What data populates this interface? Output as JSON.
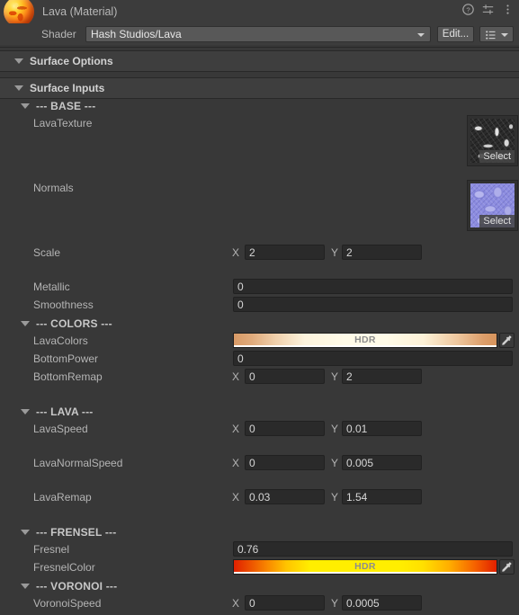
{
  "window": {
    "title": "Lava (Material)",
    "icons": [
      {
        "name": "help-icon",
        "glyph": "?"
      },
      {
        "name": "preset-icon",
        "glyph": "preset"
      },
      {
        "name": "more-menu-icon",
        "glyph": "⋮"
      }
    ]
  },
  "shader": {
    "label": "Shader",
    "value": "Hash Studios/Lava",
    "edit_label": "Edit...",
    "preset_tooltip": "Shader presets"
  },
  "sections": [
    {
      "name": "surface-options",
      "label": "Surface Options"
    },
    {
      "name": "surface-inputs",
      "label": "Surface Inputs"
    }
  ],
  "groups": {
    "base": "--- BASE ---",
    "colors": "--- COLORS ---",
    "lava": "--- LAVA ---",
    "frensel": "--- FRENSEL ---",
    "voronoi": "--- VORONOI ---"
  },
  "properties": {
    "lava_texture": {
      "label": "LavaTexture",
      "select_label": "Select"
    },
    "normals": {
      "label": "Normals",
      "select_label": "Select"
    },
    "scale": {
      "label": "Scale",
      "x_label": "X",
      "x": "2",
      "y_label": "Y",
      "y": "2"
    },
    "metallic": {
      "label": "Metallic",
      "value": "0"
    },
    "smoothness": {
      "label": "Smoothness",
      "value": "0"
    },
    "lava_colors": {
      "label": "LavaColors",
      "hdr": "HDR"
    },
    "bottom_power": {
      "label": "BottomPower",
      "value": "0"
    },
    "bottom_remap": {
      "label": "BottomRemap",
      "x_label": "X",
      "x": "0",
      "y_label": "Y",
      "y": "2"
    },
    "lava_speed": {
      "label": "LavaSpeed",
      "x_label": "X",
      "x": "0",
      "y_label": "Y",
      "y": "0.01"
    },
    "lava_normal_speed": {
      "label": "LavaNormalSpeed",
      "x_label": "X",
      "x": "0",
      "y_label": "Y",
      "y": "0.005"
    },
    "lava_remap": {
      "label": "LavaRemap",
      "x_label": "X",
      "x": "0.03",
      "y_label": "Y",
      "y": "1.54"
    },
    "fresnel": {
      "label": "Fresnel",
      "value": "0.76"
    },
    "fresnel_color": {
      "label": "FresnelColor",
      "hdr": "HDR"
    },
    "voronoi_speed": {
      "label": "VoronoiSpeed",
      "x_label": "X",
      "x": "0",
      "y_label": "Y",
      "y": "0.0005"
    }
  },
  "colors": {
    "panel_bg": "#383838",
    "header_bg": "#3e3e3e",
    "titlebar_bg": "#3c3c3c",
    "field_bg": "#2a2a2a",
    "button_bg": "#585858",
    "text": "#b4b4b4",
    "lava_colors_left": "#d89a66",
    "lava_colors_mid": "#fffbe8",
    "lava_colors_right": "#d89a66",
    "fresnel_left": "#e02000",
    "fresnel_mid": "#ffee00",
    "fresnel_right": "#e02000"
  }
}
